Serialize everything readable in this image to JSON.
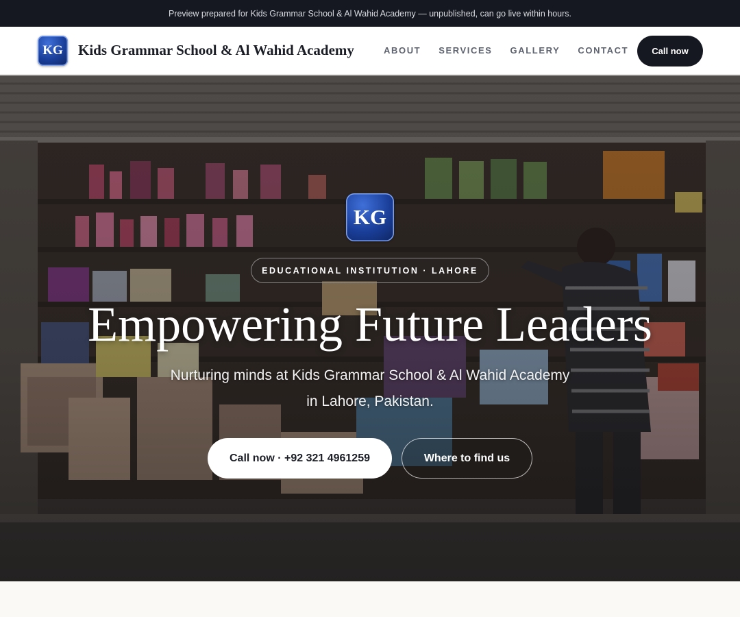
{
  "preview_banner": {
    "text": "Preview prepared for Kids Grammar School & Al Wahid Academy — unpublished, can go live within hours."
  },
  "navbar": {
    "logo_text": "KG",
    "brand_name": "Kids Grammar School & Al Wahid Academy",
    "links": [
      {
        "label": "ABOUT"
      },
      {
        "label": "SERVICES"
      },
      {
        "label": "GALLERY"
      },
      {
        "label": "CONTACT"
      }
    ],
    "cta_label": "Call now"
  },
  "hero": {
    "logo_text": "KG",
    "eyebrow": "EDUCATIONAL INSTITUTION · LAHORE",
    "title": "Empowering Future Leaders",
    "subtitle_line1": "Nurturing minds at Kids Grammar School & Al Wahid Academy",
    "subtitle_line2": "in Lahore, Pakistan.",
    "primary_button": "Call now · +92 321 4961259",
    "secondary_button": "Where to find us",
    "background_image": "shop-storefront-photo"
  },
  "colors": {
    "dark": "#151821",
    "logo_blue": "#1a3f9a",
    "white": "#ffffff",
    "page_bg": "#faf9f6"
  }
}
